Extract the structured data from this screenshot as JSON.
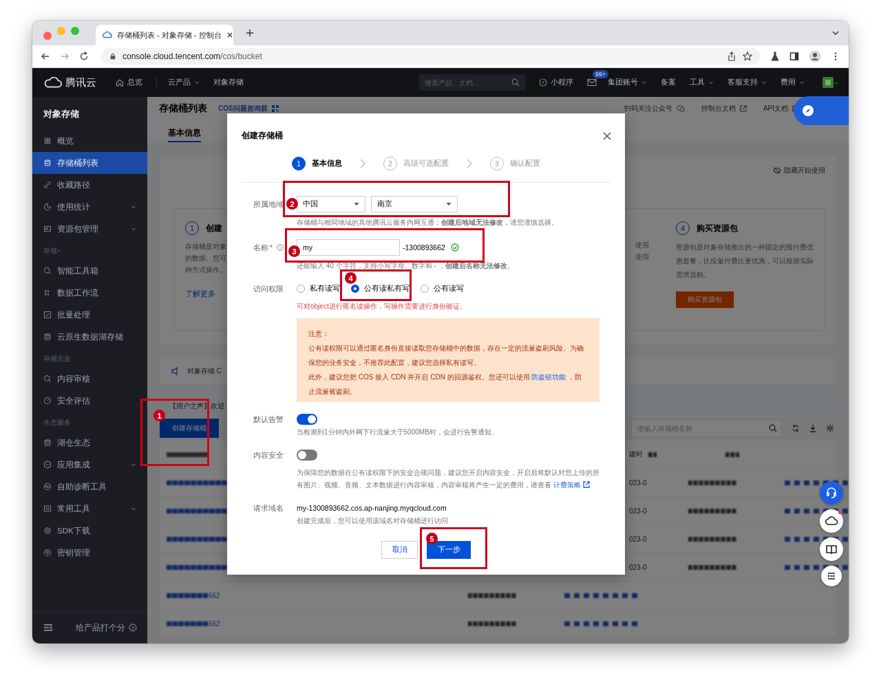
{
  "browser": {
    "tab_title": "存储桶列表 - 对象存储 - 控制台",
    "url_host": "console.cloud.tencent.com",
    "url_path": "/cos/bucket"
  },
  "topnav": {
    "brand": "腾讯云",
    "left_items": [
      {
        "kind": "home",
        "label": "总览"
      },
      {
        "kind": "menu",
        "label": "云产品"
      },
      {
        "kind": "plain",
        "label": "对象存储"
      }
    ],
    "search_placeholder": "搜索产品、文档...",
    "right_items": [
      {
        "kind": "miniapp",
        "label": "小程序"
      },
      {
        "kind": "mail",
        "badge": "99+"
      },
      {
        "kind": "menu",
        "label": "集团账号"
      },
      {
        "kind": "plain",
        "label": "备案"
      },
      {
        "kind": "menu",
        "label": "工具"
      },
      {
        "kind": "menu",
        "label": "客服支持"
      },
      {
        "kind": "menu",
        "label": "费用"
      }
    ]
  },
  "sidebar": {
    "title": "对象存储",
    "entries": [
      {
        "kind": "item",
        "label": "概览",
        "selected": false,
        "collapsible": false
      },
      {
        "kind": "item",
        "label": "存储桶列表",
        "selected": true,
        "collapsible": false
      },
      {
        "kind": "item",
        "label": "收藏路径",
        "selected": false,
        "collapsible": false
      },
      {
        "kind": "item",
        "label": "使用统计",
        "selected": false,
        "collapsible": true
      },
      {
        "kind": "item",
        "label": "资源包管理",
        "selected": false,
        "collapsible": true
      },
      {
        "kind": "heading",
        "label": "存储+"
      },
      {
        "kind": "item",
        "label": "智能工具箱",
        "selected": false,
        "collapsible": false
      },
      {
        "kind": "item",
        "label": "数据工作流",
        "selected": false,
        "collapsible": false
      },
      {
        "kind": "item",
        "label": "批量处理",
        "selected": false,
        "collapsible": false
      },
      {
        "kind": "item",
        "label": "云原生数据湖存储",
        "selected": false,
        "collapsible": false
      },
      {
        "kind": "heading",
        "label": "存储安全"
      },
      {
        "kind": "item",
        "label": "内容审核",
        "selected": false,
        "collapsible": false
      },
      {
        "kind": "item",
        "label": "安全评估",
        "selected": false,
        "collapsible": false
      },
      {
        "kind": "heading",
        "label": "生态服务"
      },
      {
        "kind": "item",
        "label": "湖仓生态",
        "selected": false,
        "collapsible": false
      },
      {
        "kind": "item",
        "label": "应用集成",
        "selected": false,
        "collapsible": true
      },
      {
        "kind": "item",
        "label": "自助诊断工具",
        "selected": false,
        "collapsible": false
      },
      {
        "kind": "item",
        "label": "常用工具",
        "selected": false,
        "collapsible": true
      },
      {
        "kind": "item",
        "label": "SDK下载",
        "selected": false,
        "collapsible": false
      },
      {
        "kind": "item",
        "label": "密钥管理",
        "selected": false,
        "collapsible": false
      }
    ],
    "footer": "给产品打个分"
  },
  "page": {
    "title": "存储桶列表",
    "group_link": "COS问题咨询群",
    "header_links": [
      {
        "kind": "wechat",
        "label": "扫码关注公众号"
      },
      {
        "kind": "external",
        "label": "控制台文档"
      },
      {
        "kind": "external",
        "label": "API文档"
      }
    ],
    "tabs": [
      {
        "label": "基本信息",
        "selected": true
      }
    ],
    "hide_link": "隐藏开始使用",
    "card_first": {
      "number": "1",
      "title": "创建",
      "lines": [
        "存储桶是对象",
        "的数据。您可",
        "种方式操作。"
      ],
      "link": "了解更多"
    },
    "card_middle_lines": [
      "使用",
      "使用"
    ],
    "card_last": {
      "number": "4",
      "title": "购买资源包",
      "text": "资源包是对象存储推出的一种固定的预付费优惠套餐，比按量付费比更优惠，可以根据实际需求选购。",
      "button": "购买资源包"
    },
    "announcement": "对象存储 C",
    "voice": "【用户之声】欢迎",
    "create_button": "创建存储桶",
    "search_placeholder": "请输入存储桶名称",
    "table": {
      "header_fragment": "建时",
      "rows": [
        {
          "kind": "covered",
          "fragment": "023-0"
        },
        {
          "kind": "covered",
          "fragment": "023-0"
        },
        {
          "kind": "covered",
          "fragment": "023-0"
        },
        {
          "kind": "covered",
          "fragment": "023-0"
        },
        {
          "kind": "full",
          "fragment": "662"
        },
        {
          "kind": "full",
          "fragment": "662"
        }
      ]
    }
  },
  "modal": {
    "title": "创建存储桶",
    "steps": [
      {
        "number": "1",
        "label": "基本信息",
        "selected": true
      },
      {
        "number": "2",
        "label": "高级可选配置",
        "selected": false
      },
      {
        "number": "3",
        "label": "确认配置",
        "selected": false
      }
    ],
    "region": {
      "label": "所属地域",
      "selects": [
        "中国",
        "南京"
      ],
      "hint": "存储桶与相同地域的其他腾讯云服务内网互通；**创建后地域无法修改**，请您谨慎选择。"
    },
    "name": {
      "label": "名称",
      "required": true,
      "required_mark": "*",
      "value": "my",
      "suffix": "-1300893662",
      "valid": true,
      "hint": "还能输入 40 个字符，支持小写字母、数字和 - ，**创建后名称无法修改**。"
    },
    "access": {
      "label": "访问权限",
      "options": [
        {
          "label": "私有读写",
          "selected": false
        },
        {
          "label": "公有读私有写",
          "selected": true
        },
        {
          "label": "公有读写",
          "selected": false
        }
      ],
      "hint": "可对object进行匿名读操作，写操作需要进行身份验证。"
    },
    "notice": {
      "title": "注意：",
      "text": "公有读权限可以通过匿名身份直接读取您存储桶中的数据，存在一定的流量盗刷风险。为确保您的业务安全，不推荐此配置，建议您选择私有读写。",
      "before": "此外，建议您把 COS 接入 CDN 并开启 CDN 的回源鉴权。您还可以使用 ",
      "link": "防盗链功能",
      "after": " ，防止流量被盗刷。"
    },
    "alarm": {
      "label": "默认告警",
      "on": true,
      "hint": "当检测到1分钟内外网下行流量大于5000MB时，会进行告警通知。"
    },
    "content_security": {
      "label": "内容安全",
      "on": false,
      "hint": "为保障您的数据在公有读权限下的安全合规问题，建议您开启内容安全，开启后将默认对您上传的所有图片、视频、音频、文本数据进行内容审核，内容审核将产生一定的费用，请查看 ",
      "link": "计费策略"
    },
    "domain": {
      "label": "请求域名",
      "value": "my-1300893662.cos.ap-nanjing.myqcloud.com",
      "hint": "创建完成后，您可以使用该域名对存储桶进行访问"
    },
    "cancel": "取消",
    "next": "下一步"
  },
  "annotations": [
    {
      "number": "1"
    },
    {
      "number": "2"
    },
    {
      "number": "3"
    },
    {
      "number": "4"
    },
    {
      "number": "5"
    }
  ]
}
